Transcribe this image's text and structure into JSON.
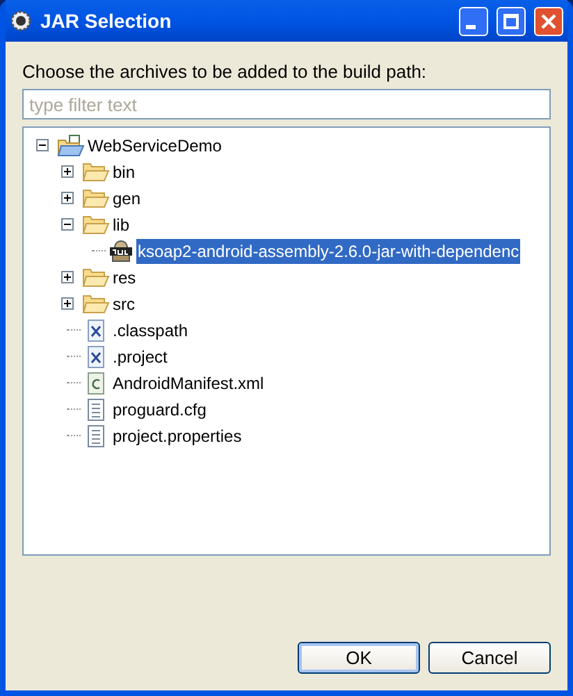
{
  "window": {
    "title": "JAR Selection"
  },
  "prompt": "Choose the archives to be added to the build path:",
  "filter": {
    "placeholder": "type filter text"
  },
  "tree": [
    {
      "label": "WebServiceDemo",
      "kind": "project",
      "expanded": true,
      "selected": false,
      "children": [
        {
          "label": "bin",
          "kind": "folder",
          "expanded": false,
          "selected": false
        },
        {
          "label": "gen",
          "kind": "folder",
          "expanded": false,
          "selected": false
        },
        {
          "label": "lib",
          "kind": "folder",
          "expanded": true,
          "selected": false,
          "children": [
            {
              "label": "ksoap2-android-assembly-2.6.0-jar-with-dependenc",
              "kind": "jar",
              "selected": true
            }
          ]
        },
        {
          "label": "res",
          "kind": "folder",
          "expanded": false,
          "selected": false
        },
        {
          "label": "src",
          "kind": "folder",
          "expanded": false,
          "selected": false
        },
        {
          "label": ".classpath",
          "kind": "xml",
          "selected": false
        },
        {
          "label": ".project",
          "kind": "xml",
          "selected": false
        },
        {
          "label": "AndroidManifest.xml",
          "kind": "manifest",
          "selected": false
        },
        {
          "label": "proguard.cfg",
          "kind": "file",
          "selected": false
        },
        {
          "label": "project.properties",
          "kind": "file",
          "selected": false
        }
      ]
    }
  ],
  "buttons": [
    {
      "label": "OK",
      "default": true
    },
    {
      "label": "Cancel",
      "default": false
    }
  ]
}
